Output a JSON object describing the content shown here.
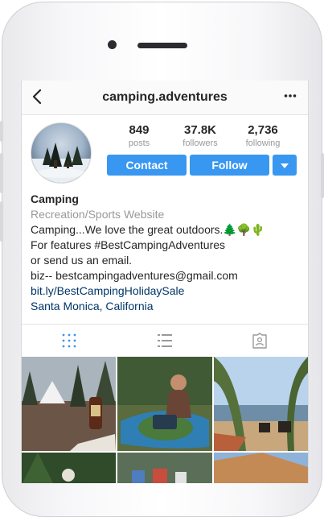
{
  "profile": {
    "username": "camping.adventures",
    "stats": [
      {
        "value": "849",
        "label": "posts"
      },
      {
        "value": "37.8K",
        "label": "followers"
      },
      {
        "value": "2,736",
        "label": "following"
      }
    ],
    "contact_label": "Contact",
    "follow_label": "Follow",
    "name": "Camping",
    "category": "Recreation/Sports Website",
    "bio_lines": [
      "Camping...We love the great outdoors.🌲🌳🌵",
      "For features #BestCampingAdventures",
      "or send us an email.",
      "biz-- bestcampingadventures@gmail.com"
    ],
    "website": "bit.ly/BestCampingHolidaySale",
    "location": "Santa Monica, California"
  },
  "icons": {
    "back": "back-chevron-icon",
    "more": "more-options-icon",
    "dropdown": "chevron-down-icon",
    "grid_tab": "grid-icon",
    "list_tab": "list-icon",
    "tagged_tab": "tagged-photos-icon"
  },
  "colors": {
    "accent": "#3897f0",
    "link": "#003569",
    "muted": "#999999",
    "text": "#262626"
  }
}
